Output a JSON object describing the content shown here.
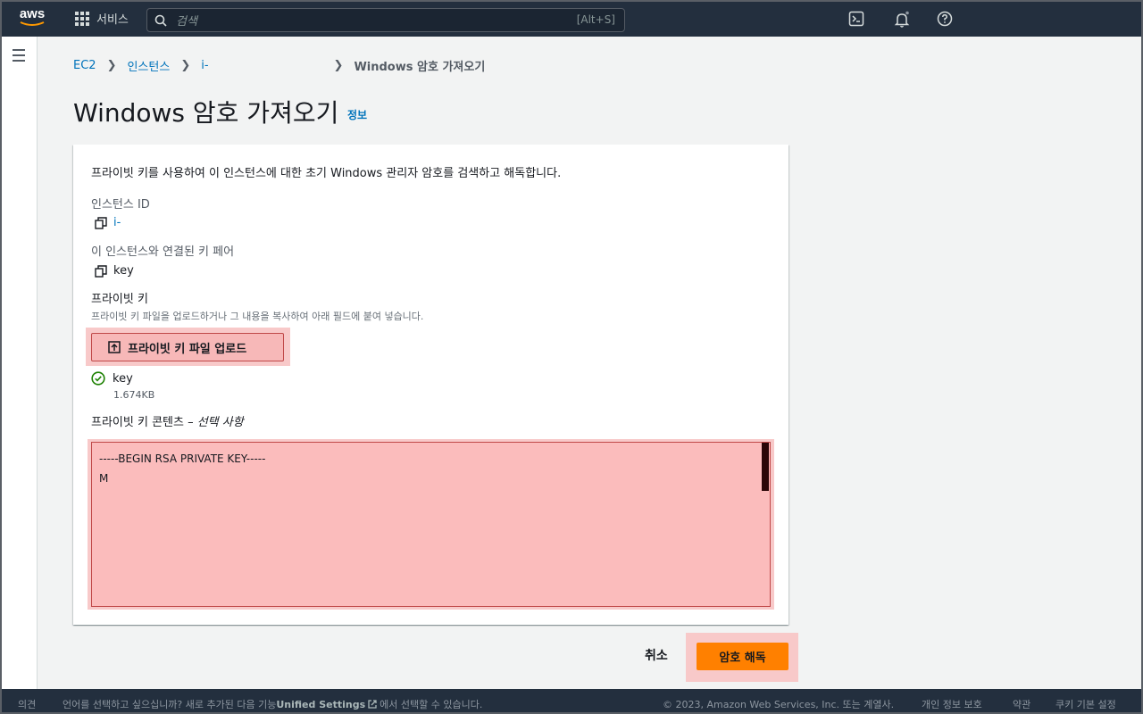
{
  "topnav": {
    "logo_text": "aws",
    "services_label": "서비스",
    "search_placeholder": "검색",
    "search_shortcut": "[Alt+S]",
    "icons": [
      "cloudshell-icon",
      "bell-icon",
      "help-icon"
    ]
  },
  "breadcrumb": {
    "items": [
      "EC2",
      "인스턴스",
      "i-"
    ],
    "current": "Windows 암호 가져오기"
  },
  "page": {
    "title": "Windows 암호 가져오기",
    "info_link": "정보"
  },
  "form": {
    "intro": "프라이빗 키를 사용하여 이 인스턴스에 대한 초기 Windows 관리자 암호를 검색하고 해독합니다.",
    "instance_id_label": "인스턴스 ID",
    "instance_id_value": "i-",
    "key_pair_label": "이 인스턴스와 연결된 키 페어",
    "key_pair_value": "key",
    "private_key_label": "프라이빗 키",
    "private_key_hint": "프라이빗 키 파일을 업로드하거나 그 내용을 복사하여 아래 필드에 붙여 넣습니다.",
    "upload_button": "프라이빗 키 파일 업로드",
    "uploaded_file_name": "key",
    "uploaded_file_size": "1.674KB",
    "contents_label": "프라이빗 키 콘텐츠 –",
    "contents_optional": "선택 사항",
    "contents_value": "-----BEGIN RSA PRIVATE KEY-----\nM"
  },
  "actions": {
    "cancel": "취소",
    "decrypt": "암호 해독"
  },
  "footer": {
    "feedback": "의견",
    "language_prompt": "언어를 선택하고 싶으십니까? 새로 추가된 다음 기능",
    "unified_settings": "Unified Settings",
    "language_suffix": "에서 선택할 수 있습니다.",
    "copyright": "© 2023, Amazon Web Services, Inc. 또는 계열사.",
    "privacy": "개인 정보 보호",
    "terms": "약관",
    "cookies": "쿠키 기본 설정"
  },
  "colors": {
    "nav_bg": "#232f3e",
    "link": "#0073bb",
    "primary_button": "#ff8000",
    "highlight": "#f8c9c9",
    "success": "#1d8102"
  }
}
